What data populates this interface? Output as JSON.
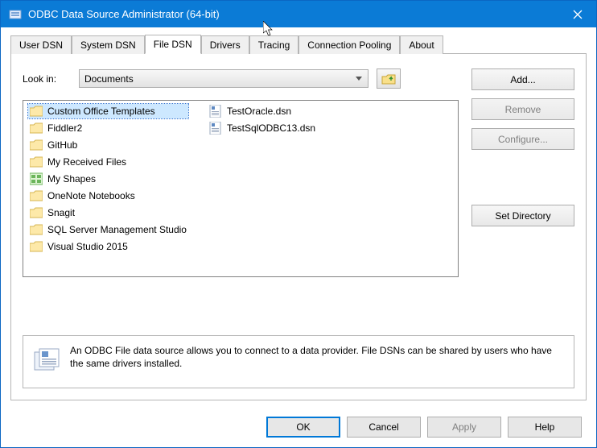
{
  "window": {
    "title": "ODBC Data Source Administrator (64-bit)"
  },
  "tabs": [
    {
      "label": "User DSN"
    },
    {
      "label": "System DSN"
    },
    {
      "label": "File DSN"
    },
    {
      "label": "Drivers"
    },
    {
      "label": "Tracing"
    },
    {
      "label": "Connection Pooling"
    },
    {
      "label": "About"
    }
  ],
  "active_tab": "File DSN",
  "lookin": {
    "label": "Look in:",
    "value": "Documents"
  },
  "buttons": {
    "add": "Add...",
    "remove": "Remove",
    "configure": "Configure...",
    "set_directory": "Set Directory",
    "ok": "OK",
    "cancel": "Cancel",
    "apply": "Apply",
    "help": "Help"
  },
  "filelist": {
    "col1": [
      {
        "type": "folder",
        "name": "Custom Office Templates",
        "selected": true
      },
      {
        "type": "folder",
        "name": "Fiddler2"
      },
      {
        "type": "folder",
        "name": "GitHub"
      },
      {
        "type": "folder",
        "name": "My Received Files"
      },
      {
        "type": "visio",
        "name": "My Shapes"
      },
      {
        "type": "folder",
        "name": "OneNote Notebooks"
      },
      {
        "type": "folder",
        "name": "Snagit"
      },
      {
        "type": "folder",
        "name": "SQL Server Management Studio"
      },
      {
        "type": "folder",
        "name": "Visual Studio 2015"
      }
    ],
    "col2": [
      {
        "type": "dsn",
        "name": "TestOracle.dsn"
      },
      {
        "type": "dsn",
        "name": "TestSqlODBC13.dsn"
      }
    ]
  },
  "description": "An ODBC File data source allows you to connect to a data provider.  File DSNs can be shared by users who have the same drivers installed."
}
